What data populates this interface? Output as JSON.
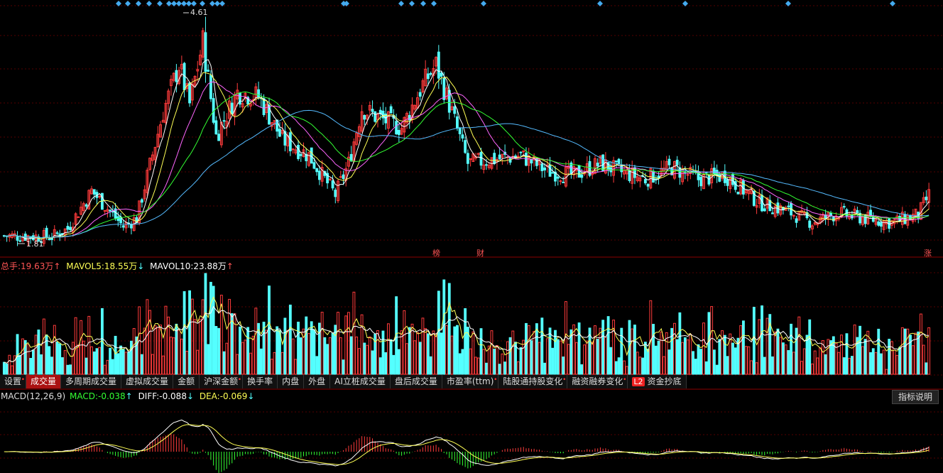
{
  "colors": {
    "up": "#ff3b3b",
    "down": "#54ffff",
    "ma5": "#ffffff",
    "ma10": "#ffff55",
    "ma20": "#ff66ff",
    "ma30": "#33ff33",
    "ma60": "#55bbff",
    "grid": "#550000",
    "signal": "#44aaee"
  },
  "price": {
    "high_label": "4.61",
    "low_label": "1.81",
    "markers": [
      "榜",
      "财",
      "涨"
    ]
  },
  "volume_legend": {
    "total_label": "总手:",
    "total_value": "19.63万",
    "ma5_label": "MAVOL5:",
    "ma5_value": "18.55万",
    "ma10_label": "MAVOL10:",
    "ma10_value": "23.88万"
  },
  "tabs": [
    {
      "label": "设置",
      "dot": true
    },
    {
      "label": "成交量",
      "active": true
    },
    {
      "label": "多周期成交量"
    },
    {
      "label": "虚拟成交量"
    },
    {
      "label": "金额"
    },
    {
      "label": "沪深金额",
      "dot": true
    },
    {
      "label": "换手率"
    },
    {
      "label": "内盘"
    },
    {
      "label": "外盘"
    },
    {
      "label": "AI立桩成交量"
    },
    {
      "label": "盘后成交量"
    },
    {
      "label": "市盈率(ttm)",
      "dot": true
    },
    {
      "label": "陆股通持股变化",
      "dot": true
    },
    {
      "label": "融资融券变化",
      "dot": true
    },
    {
      "label": "资金抄底",
      "badge": "L2"
    }
  ],
  "macd_legend": {
    "name": "MACD(12,26,9)",
    "macd_label": "MACD:",
    "macd_value": "-0.038",
    "diff_label": "DIFF:",
    "diff_value": "-0.088",
    "dea_label": "DEA:",
    "dea_value": "-0.069"
  },
  "help_button": "指标说明",
  "chart_data": [
    {
      "type": "candlestick",
      "title": "",
      "high": 4.61,
      "low": 1.81,
      "anchors": [
        [
          0,
          1.83
        ],
        [
          18,
          1.82
        ],
        [
          24,
          1.92
        ],
        [
          33,
          2.4
        ],
        [
          45,
          1.95
        ],
        [
          50,
          2.05
        ],
        [
          60,
          3.4
        ],
        [
          66,
          4.0
        ],
        [
          70,
          3.5
        ],
        [
          75,
          4.3
        ],
        [
          80,
          3.1
        ],
        [
          88,
          3.65
        ],
        [
          96,
          3.6
        ],
        [
          105,
          3.05
        ],
        [
          115,
          2.85
        ],
        [
          125,
          2.35
        ],
        [
          130,
          2.75
        ],
        [
          135,
          3.45
        ],
        [
          140,
          3.35
        ],
        [
          150,
          3.2
        ],
        [
          158,
          3.75
        ],
        [
          163,
          4.0
        ],
        [
          168,
          3.5
        ],
        [
          175,
          2.75
        ],
        [
          185,
          2.8
        ],
        [
          195,
          2.85
        ],
        [
          205,
          2.65
        ],
        [
          215,
          2.6
        ],
        [
          225,
          2.75
        ],
        [
          232,
          2.65
        ],
        [
          242,
          2.55
        ],
        [
          252,
          2.7
        ],
        [
          262,
          2.55
        ],
        [
          272,
          2.6
        ],
        [
          285,
          2.25
        ],
        [
          295,
          2.15
        ],
        [
          305,
          2.0
        ],
        [
          315,
          2.12
        ],
        [
          325,
          2.05
        ],
        [
          335,
          2.0
        ],
        [
          345,
          2.1
        ],
        [
          349,
          2.35
        ]
      ]
    },
    {
      "type": "bar",
      "title": "成交量",
      "series": [
        {
          "name": "MAVOL5"
        },
        {
          "name": "MAVOL10"
        }
      ]
    },
    {
      "type": "bar",
      "title": "MACD(12,26,9)",
      "series": [
        {
          "name": "DIFF"
        },
        {
          "name": "DEA"
        }
      ]
    }
  ]
}
